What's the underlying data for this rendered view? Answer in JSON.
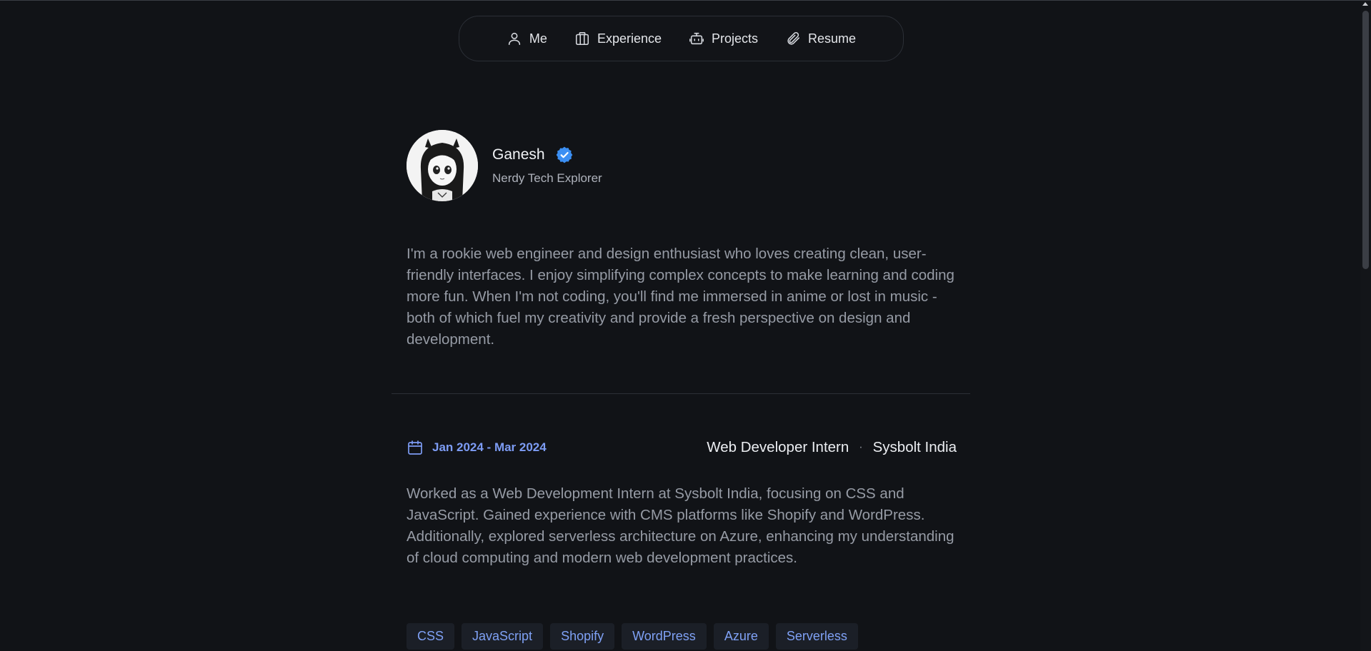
{
  "nav": {
    "items": [
      {
        "label": "Me",
        "icon": "user-icon"
      },
      {
        "label": "Experience",
        "icon": "briefcase-icon"
      },
      {
        "label": "Projects",
        "icon": "robot-icon"
      },
      {
        "label": "Resume",
        "icon": "paperclip-icon"
      }
    ]
  },
  "profile": {
    "name": "Ganesh",
    "tagline": "Nerdy Tech Explorer",
    "verified_color": "#3b8ff3"
  },
  "bio": "I'm a rookie web engineer and design enthusiast who loves creating clean, user-friendly interfaces. I enjoy simplifying complex concepts to make learning and coding more fun. When I'm not coding, you'll find me immersed in anime or lost in music - both of which fuel my creativity and provide a fresh perspective on design and development.",
  "experience": {
    "date_range": "Jan 2024 - Mar 2024",
    "role": "Web Developer Intern",
    "separator": "·",
    "company": "Sysbolt India",
    "description": "Worked as a Web Development Intern at Sysbolt India, focusing on CSS and JavaScript. Gained experience with CMS platforms like Shopify and WordPress. Additionally, explored serverless architecture on Azure, enhancing my understanding of cloud computing and modern web development practices.",
    "tags": [
      "CSS",
      "JavaScript",
      "Shopify",
      "WordPress",
      "Azure",
      "Serverless"
    ]
  },
  "colors": {
    "background": "#111317",
    "accent": "#7d9cf4",
    "text_muted": "#969ba5"
  }
}
